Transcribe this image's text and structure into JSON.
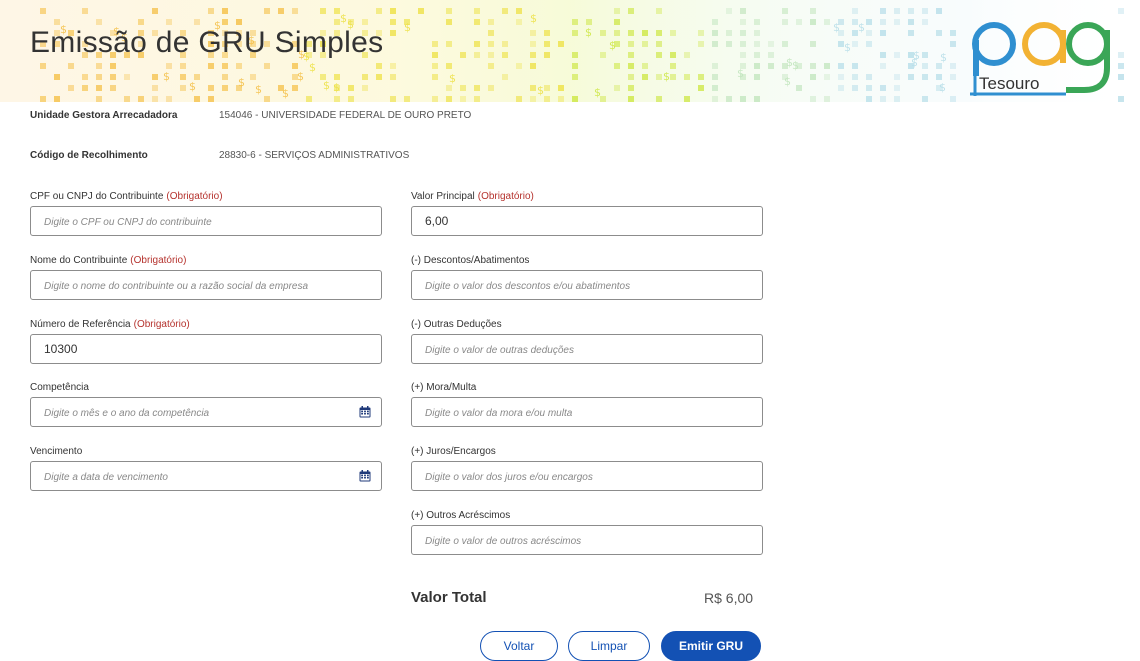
{
  "header": {
    "title": "Emissão de GRU Simples",
    "logo_letters": "pag",
    "logo_word": "Tesouro"
  },
  "info": [
    {
      "label": "Unidade Gestora Arrecadadora",
      "value": "154046 - UNIVERSIDADE FEDERAL DE OURO PRETO"
    },
    {
      "label": "Código de Recolhimento",
      "value": "28830-6 - SERVIÇOS ADMINISTRATIVOS"
    }
  ],
  "required_tag": "(Obrigatório)",
  "left_fields": [
    {
      "label": "CPF ou CNPJ do Contribuinte",
      "required": true,
      "value": "",
      "placeholder": "Digite o CPF ou CNPJ do contribuinte",
      "calendar": false
    },
    {
      "label": "Nome do Contribuinte",
      "required": true,
      "value": "",
      "placeholder": "Digite o nome do contribuinte ou a razão social da empresa",
      "calendar": false
    },
    {
      "label": "Número de Referência",
      "required": true,
      "value": "10300",
      "placeholder": "",
      "calendar": false
    },
    {
      "label": "Competência",
      "required": false,
      "value": "",
      "placeholder": "Digite o mês e o ano da competência",
      "calendar": true
    },
    {
      "label": "Vencimento",
      "required": false,
      "value": "",
      "placeholder": "Digite a data de vencimento",
      "calendar": true
    }
  ],
  "right_fields": [
    {
      "label": "Valor Principal",
      "required": true,
      "value": "6,00",
      "placeholder": ""
    },
    {
      "label": "(-) Descontos/Abatimentos",
      "required": false,
      "value": "",
      "placeholder": "Digite o valor dos descontos e/ou abatimentos"
    },
    {
      "label": "(-) Outras Deduções",
      "required": false,
      "value": "",
      "placeholder": "Digite o valor de outras deduções"
    },
    {
      "label": "(+) Mora/Multa",
      "required": false,
      "value": "",
      "placeholder": "Digite o valor da mora e/ou multa"
    },
    {
      "label": "(+) Juros/Encargos",
      "required": false,
      "value": "",
      "placeholder": "Digite o valor dos juros e/ou encargos"
    },
    {
      "label": "(+) Outros Acréscimos",
      "required": false,
      "value": "",
      "placeholder": "Digite o valor de outros acréscimos"
    }
  ],
  "total": {
    "label": "Valor Total",
    "value": "R$ 6,00"
  },
  "buttons": {
    "back": "Voltar",
    "clear": "Limpar",
    "emit": "Emitir GRU"
  },
  "icons": {
    "calendar": "calendar-icon"
  },
  "colors": {
    "primary": "#1351b4",
    "required": "#b5322d",
    "border": "#8c8c8c"
  }
}
